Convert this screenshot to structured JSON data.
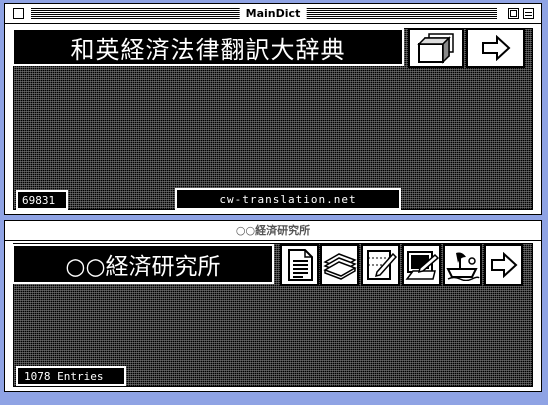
{
  "window1": {
    "title": "MainDict",
    "banner_title": "和英経済法律翻訳大辞典",
    "entry_count": "69831",
    "url": "cw-translation.net",
    "buttons": [
      {
        "icon": "stacked-folders-icon"
      },
      {
        "icon": "right-arrow-icon"
      }
    ]
  },
  "window2": {
    "title": "○○経済研究所",
    "banner_title": "○○経済研究所",
    "entry_count": "1078 Entries",
    "buttons": [
      {
        "icon": "document-icon"
      },
      {
        "icon": "stacked-disks-icon"
      },
      {
        "icon": "note-pencil-icon"
      },
      {
        "icon": "monitor-edit-icon"
      },
      {
        "icon": "ship-icon"
      },
      {
        "icon": "right-arrow-icon"
      }
    ]
  },
  "colors": {
    "desktop": "#8fa3e4",
    "panel": "#000000",
    "window": "#ffffff"
  }
}
